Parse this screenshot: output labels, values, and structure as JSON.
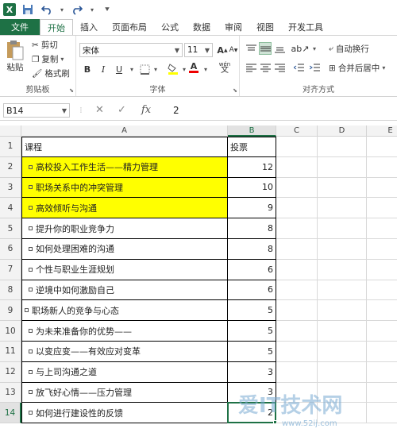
{
  "quick_access": {
    "logo": "X",
    "save_icon": "save-icon",
    "undo_icon": "undo-icon",
    "redo_icon": "redo-icon",
    "customize_icon": "customize-qat-icon"
  },
  "tabs": [
    {
      "label": "文件",
      "kind": "file"
    },
    {
      "label": "开始",
      "kind": "active"
    },
    {
      "label": "插入",
      "kind": ""
    },
    {
      "label": "页面布局",
      "kind": ""
    },
    {
      "label": "公式",
      "kind": ""
    },
    {
      "label": "数据",
      "kind": ""
    },
    {
      "label": "审阅",
      "kind": ""
    },
    {
      "label": "视图",
      "kind": ""
    },
    {
      "label": "开发工具",
      "kind": ""
    }
  ],
  "ribbon": {
    "clipboard": {
      "paste": "粘贴",
      "cut": "剪切",
      "copy": "复制",
      "format_painter": "格式刷",
      "label": "剪贴板"
    },
    "font": {
      "name": "宋体",
      "size": "11",
      "bold": "B",
      "italic": "I",
      "underline": "U",
      "grow": "A",
      "shrink": "A",
      "font_color_letter": "A",
      "pinyin": "wén",
      "label": "字体"
    },
    "alignment": {
      "wrap_text": "自动换行",
      "merge_center": "合并后居中",
      "label": "对齐方式"
    }
  },
  "formula_bar": {
    "name_box": "B14",
    "cancel": "✕",
    "enter": "✓",
    "fx": "fx",
    "value": "2"
  },
  "columns": [
    "A",
    "B",
    "C",
    "D",
    "E"
  ],
  "rows": [
    {
      "num": "1",
      "a": "课程",
      "b": "投票",
      "yellow": false,
      "header": true
    },
    {
      "num": "2",
      "a": "高校投入工作生活——精力管理",
      "b": "12",
      "yellow": true
    },
    {
      "num": "3",
      "a": "职场关系中的冲突管理",
      "b": "10",
      "yellow": true
    },
    {
      "num": "4",
      "a": "高效倾听与沟通",
      "b": "9",
      "yellow": true
    },
    {
      "num": "5",
      "a": "提升你的职业竞争力",
      "b": "8",
      "yellow": false
    },
    {
      "num": "6",
      "a": "如何处理困难的沟通",
      "b": "8",
      "yellow": false
    },
    {
      "num": "7",
      "a": "个性与职业生涯规划",
      "b": "6",
      "yellow": false
    },
    {
      "num": "8",
      "a": "逆境中如何激励自己",
      "b": "6",
      "yellow": false
    },
    {
      "num": "9",
      "a": "职场新人的竞争与心态",
      "b": "5",
      "yellow": false,
      "flush": true
    },
    {
      "num": "10",
      "a": "为未来准备你的优势——",
      "b": "5",
      "yellow": false
    },
    {
      "num": "11",
      "a": "以变应变——有效应对变革",
      "b": "5",
      "yellow": false
    },
    {
      "num": "12",
      "a": "与上司沟通之道",
      "b": "3",
      "yellow": false
    },
    {
      "num": "13",
      "a": "放飞好心情——压力管理",
      "b": "3",
      "yellow": false
    },
    {
      "num": "14",
      "a": "如何进行建设性的反馈",
      "b": "2",
      "yellow": false
    }
  ],
  "colors": {
    "accent": "#1e7145",
    "highlight": "#ffff00"
  },
  "watermark": {
    "main": "爱IT技术网",
    "sub": "www.52ij.com"
  }
}
